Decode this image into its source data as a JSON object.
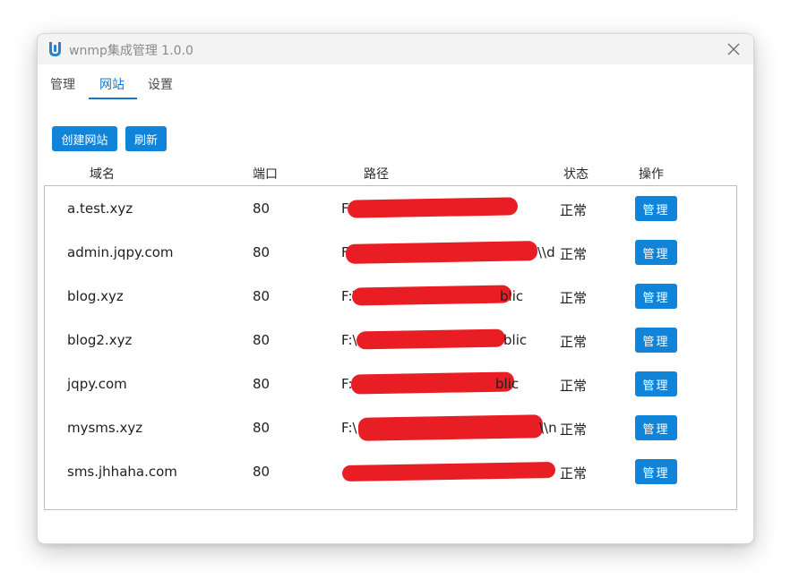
{
  "window": {
    "title": "wnmp集成管理 1.0.0"
  },
  "tabs": [
    {
      "label": "管理"
    },
    {
      "label": "网站"
    },
    {
      "label": "设置"
    }
  ],
  "toolbar": {
    "create_label": "创建网站",
    "refresh_label": "刷新"
  },
  "table": {
    "headers": {
      "domain": "域名",
      "port": "端口",
      "path": "路径",
      "status": "状态",
      "action": "操作"
    },
    "rows": [
      {
        "domain": "a.test.xyz",
        "port": "80",
        "path_visible": "F:\\",
        "status": "正常",
        "action": "管理"
      },
      {
        "domain": "admin.jqpy.com",
        "port": "80",
        "path_visible": "F:\\\\",
        "path_tail": "\\\\d",
        "status": "正常",
        "action": "管理"
      },
      {
        "domain": "blog.xyz",
        "port": "80",
        "path_visible": "F:\\",
        "path_tail": "blic",
        "status": "正常",
        "action": "管理"
      },
      {
        "domain": "blog2.xyz",
        "port": "80",
        "path_visible": "F:\\",
        "path_tail": "blic",
        "status": "正常",
        "action": "管理"
      },
      {
        "domain": "jqpy.com",
        "port": "80",
        "path_visible": "F:\\",
        "path_tail": "blic",
        "status": "正常",
        "action": "管理"
      },
      {
        "domain": "mysms.xyz",
        "port": "80",
        "path_visible": "F:\\",
        "path_tail": "\\\\n",
        "status": "正常",
        "action": "管理"
      },
      {
        "domain": "sms.jhhaha.com",
        "port": "80",
        "path_visible": "",
        "path_tail": "",
        "status": "正常",
        "action": "管理"
      }
    ]
  },
  "colors": {
    "accent": "#1677cc",
    "button": "#0f84d9",
    "redaction": "#e81e24"
  }
}
